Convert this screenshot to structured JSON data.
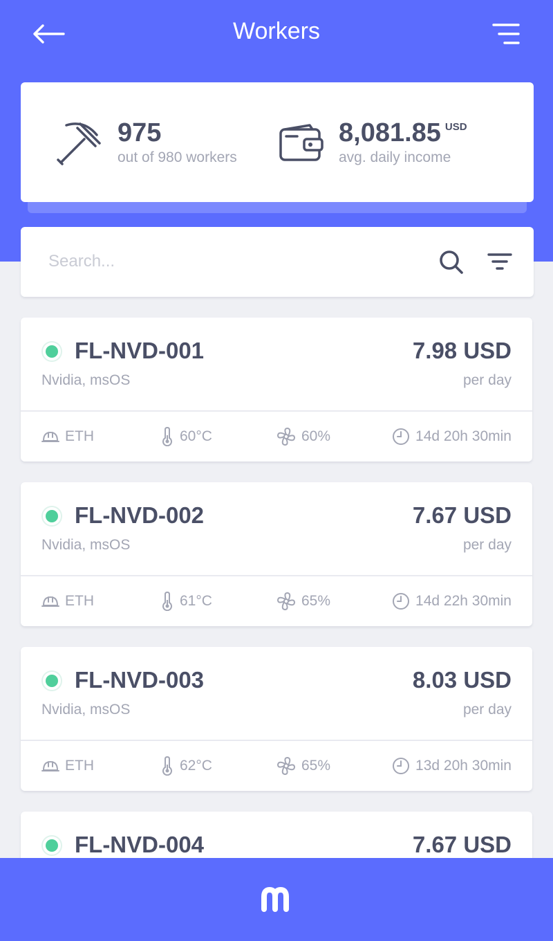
{
  "header": {
    "title": "Workers",
    "back_icon": "arrow-left-icon",
    "menu_icon": "menu-icon"
  },
  "stats": {
    "workers": {
      "icon": "pickaxe-icon",
      "value": "975",
      "caption": "out of 980 workers"
    },
    "income": {
      "icon": "wallet-icon",
      "value": "8,081.85",
      "unit": "USD",
      "caption": "avg. daily income"
    }
  },
  "search": {
    "placeholder": "Search...",
    "value": "",
    "search_icon": "search-icon",
    "filter_icon": "filter-icon"
  },
  "workers": [
    {
      "name": "FL-NVD-001",
      "hardware": "Nvidia, msOS",
      "income": "7.98 USD",
      "period": "per day",
      "status": "online",
      "coin": "ETH",
      "temperature": "60°C",
      "fan": "60%",
      "uptime": "14d 20h 30min"
    },
    {
      "name": "FL-NVD-002",
      "hardware": "Nvidia, msOS",
      "income": "7.67 USD",
      "period": "per day",
      "status": "online",
      "coin": "ETH",
      "temperature": "61°C",
      "fan": "65%",
      "uptime": "14d 22h 30min"
    },
    {
      "name": "FL-NVD-003",
      "hardware": "Nvidia, msOS",
      "income": "8.03 USD",
      "period": "per day",
      "status": "online",
      "coin": "ETH",
      "temperature": "62°C",
      "fan": "65%",
      "uptime": "13d 20h 30min"
    },
    {
      "name": "FL-NVD-004",
      "income": "7.67 USD",
      "status": "online"
    }
  ],
  "bottom_bar": {
    "logo_icon": "m-logo-icon"
  },
  "colors": {
    "accent": "#5b6cfe",
    "accent_light": "#7b89fe",
    "online": "#4fcf9b",
    "text_dark": "#4a4f66",
    "text_muted": "#a3a6b4",
    "background": "#eff0f4"
  }
}
